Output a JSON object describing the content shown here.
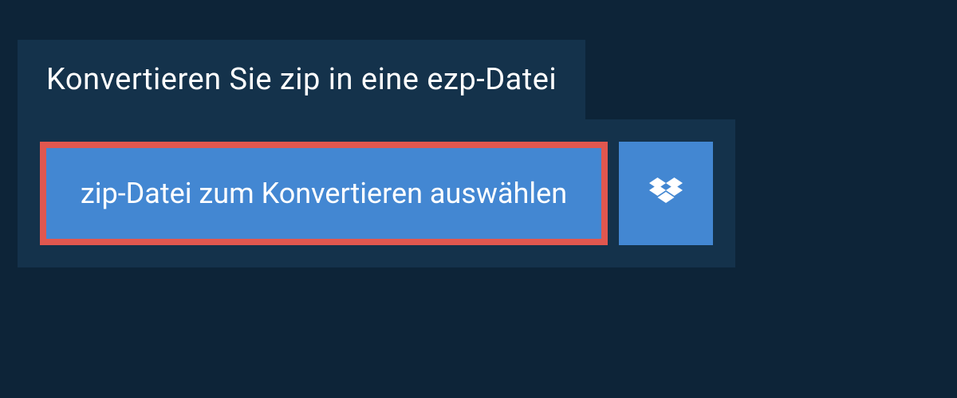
{
  "header": {
    "title": "Konvertieren Sie zip in eine ezp-Datei"
  },
  "actions": {
    "select_file_label": "zip-Datei zum Konvertieren auswählen"
  }
}
